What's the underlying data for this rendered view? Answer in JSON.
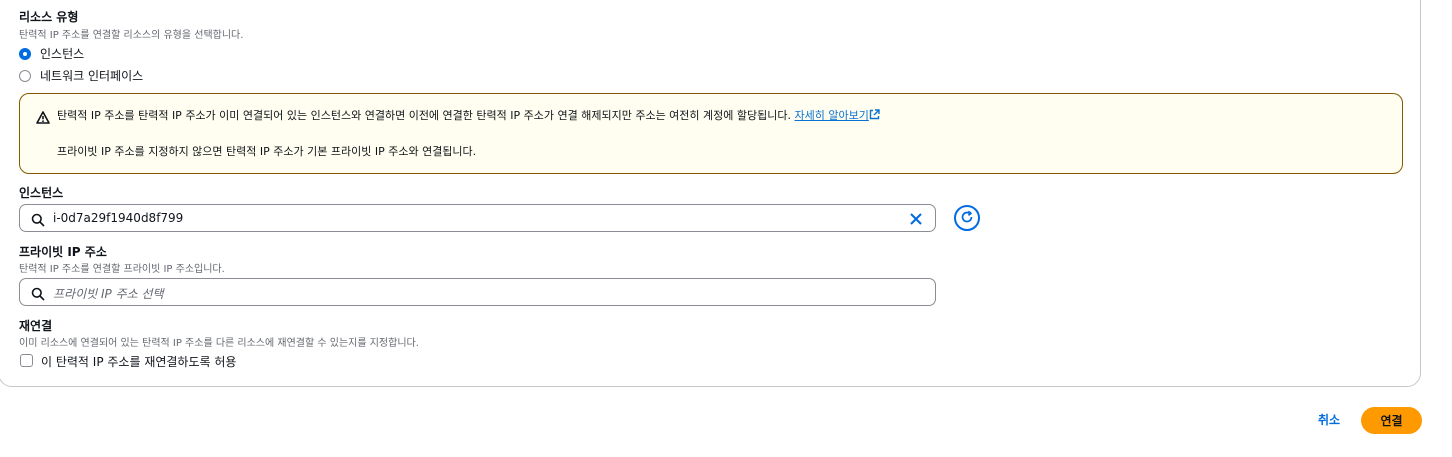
{
  "resource_type": {
    "label": "리소스 유형",
    "description": "탄력적 IP 주소를 연결할 리소스의 유형을 선택합니다.",
    "options": [
      {
        "label": "인스턴스",
        "selected": true
      },
      {
        "label": "네트워크 인터페이스",
        "selected": false
      }
    ]
  },
  "alert": {
    "line1": "탄력적 IP 주소를 탄력적 IP 주소가 이미 연결되어 있는 인스턴스와 연결하면 이전에 연결한 탄력적 IP 주소가 연결 해제되지만 주소는 여전히 계정에 할당됩니다.",
    "link": "자세히 알아보기",
    "line2": "프라이빗 IP 주소를 지정하지 않으면 탄력적 IP 주소가 기본 프라이빗 IP 주소와 연결됩니다.",
    "icon": "warning-icon",
    "colors": {
      "border": "#855900",
      "background": "#fffef0"
    }
  },
  "instance": {
    "label": "인스턴스",
    "value": "i-0d7a29f1940d8f799"
  },
  "private_ip": {
    "label": "프라이빗 IP 주소",
    "description": "탄력적 IP 주소를 연결할 프라이빗 IP 주소입니다.",
    "placeholder": "프라이빗 IP 주소 선택"
  },
  "reassociation": {
    "label": "재연결",
    "description": "이미 리소스에 연결되어 있는 탄력적 IP 주소를 다른 리소스에 재연결할 수 있는지를 지정합니다.",
    "checkbox_label": "이 탄력적 IP 주소를 재연결하도록 허용",
    "checked": false
  },
  "actions": {
    "cancel": "취소",
    "connect": "연결",
    "accent": "#ff9900",
    "link_color": "#006ce0"
  }
}
